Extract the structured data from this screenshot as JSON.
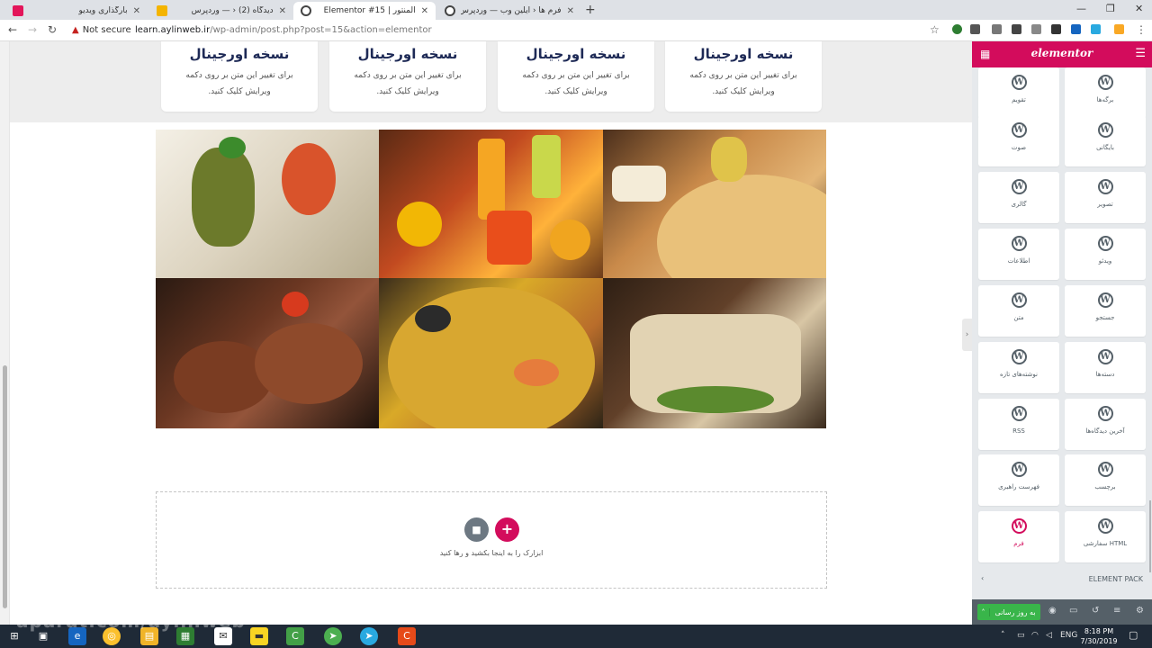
{
  "browser": {
    "tabs": [
      {
        "label": "بارگذاری ویدیو",
        "favicon": "aparat-icon",
        "color": "#e3155a"
      },
      {
        "label": "دیدگاه (2) ‹ — وردپرس",
        "favicon": "wordpress-admin-icon",
        "color": "#444444"
      },
      {
        "label": "المنتور | Elementor #15",
        "favicon": "elementor-icon",
        "color": "#444444"
      },
      {
        "label": "فرم ها ‹ آیلین وب — وردپرس",
        "favicon": "wordpress-icon",
        "color": "#444444"
      }
    ],
    "active_tab": 2,
    "security_label": "Not secure",
    "url_host": "learn.aylinweb.ir",
    "url_path": "/wp-admin/post.php?post=15&action=elementor"
  },
  "cards": [
    {
      "title": "نسخه اورجینال",
      "text": "برای تغییر این متن بر روی دکمه ویرایش کلیک کنید."
    },
    {
      "title": "نسخه اورجینال",
      "text": "برای تغییر این متن بر روی دکمه ویرایش کلیک کنید."
    },
    {
      "title": "نسخه اورجینال",
      "text": "برای تغییر این متن بر روی دکمه ویرایش کلیک کنید."
    },
    {
      "title": "نسخه اورجینال",
      "text": "برای تغییر این متن بر روی دکمه ویرایش کلیک کنید."
    }
  ],
  "gallery": [
    {
      "name": "gallery-image-grilled-stack"
    },
    {
      "name": "gallery-image-fruit-juices"
    },
    {
      "name": "gallery-image-pizza"
    },
    {
      "name": "gallery-image-steak"
    },
    {
      "name": "gallery-image-paella"
    },
    {
      "name": "gallery-image-sandwich"
    }
  ],
  "drop_zone": {
    "hint": "ابزارک را به اینجا بکشید و رها کنید"
  },
  "panel": {
    "brand": "elementor",
    "widgets": [
      {
        "label": "برگه‌ها",
        "icon": "wordpress-icon"
      },
      {
        "label": "تقویم",
        "icon": "wordpress-icon"
      },
      {
        "label": "بایگانی",
        "icon": "wordpress-icon"
      },
      {
        "label": "صوت",
        "icon": "wordpress-icon"
      },
      {
        "label": "تصویر",
        "icon": "wordpress-icon"
      },
      {
        "label": "گالری",
        "icon": "wordpress-icon"
      },
      {
        "label": "ویدئو",
        "icon": "wordpress-icon"
      },
      {
        "label": "اطلاعات",
        "icon": "wordpress-icon"
      },
      {
        "label": "جستجو",
        "icon": "wordpress-icon"
      },
      {
        "label": "متن",
        "icon": "wordpress-icon"
      },
      {
        "label": "دسته‌ها",
        "icon": "wordpress-icon"
      },
      {
        "label": "نوشته‌های تازه",
        "icon": "wordpress-icon"
      },
      {
        "label": "آخرین دیدگاه‌ها",
        "icon": "wordpress-icon"
      },
      {
        "label": "RSS",
        "icon": "wordpress-icon"
      },
      {
        "label": "برچسب",
        "icon": "wordpress-icon"
      },
      {
        "label": "فهرست راهبری",
        "icon": "wordpress-icon"
      },
      {
        "label": "HTML سفارشی",
        "icon": "wordpress-icon"
      },
      {
        "label": "فرم",
        "icon": "wordpress-icon",
        "highlighted": true
      }
    ],
    "section_title": "ELEMENT PACK",
    "publish_label": "به روز رسانی"
  },
  "taskbar": {
    "language": "ENG",
    "time": "8:18 PM",
    "date": "7/30/2019"
  },
  "watermark": "aparat.com/aylinweb",
  "colors": {
    "elementor_pink": "#d30c5c",
    "publish_green": "#39b54a",
    "panel_bg": "#e6e9ec"
  }
}
